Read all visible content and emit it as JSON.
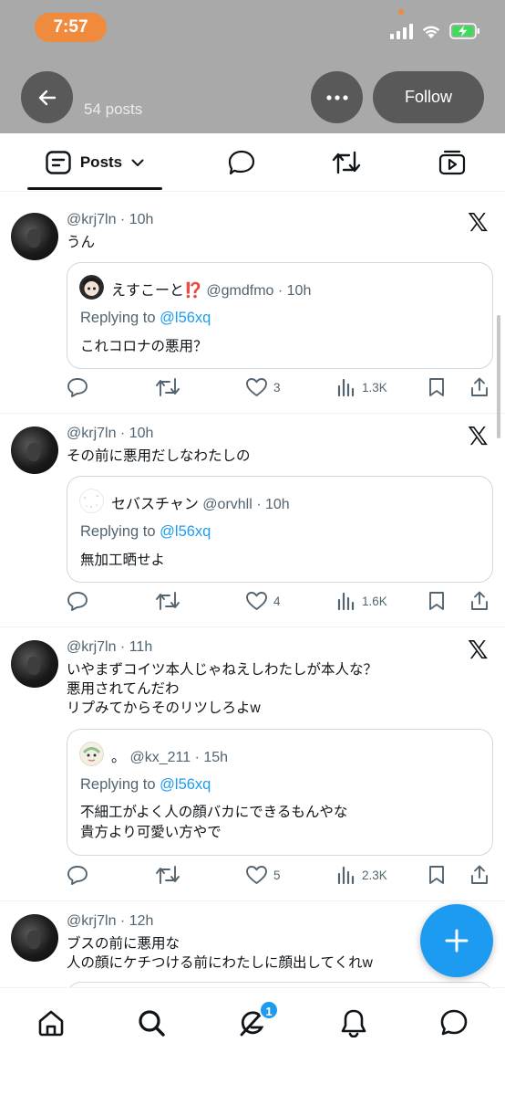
{
  "status_bar": {
    "time": "7:57"
  },
  "header": {
    "post_count": "54 posts",
    "follow_label": "Follow"
  },
  "tabs": [
    {
      "label": "Posts"
    }
  ],
  "posts": [
    {
      "handle": "@krj7ln",
      "time": "10h",
      "text": "うん",
      "quote": {
        "name": "えすこーと⁉️",
        "handle": "@gmdfmo",
        "time": "10h",
        "replying_to_label": "Replying to",
        "replying_to": "@l56xq",
        "text": "これコロナの悪用？"
      },
      "stats": {
        "likes": "3",
        "views": "1.3K"
      }
    },
    {
      "handle": "@krj7ln",
      "time": "10h",
      "text": "その前に悪用だしなわたしの",
      "quote": {
        "name": "セバスチャン",
        "handle": "@orvhll",
        "time": "10h",
        "replying_to_label": "Replying to",
        "replying_to": "@l56xq",
        "text": "無加工晒せよ"
      },
      "stats": {
        "likes": "4",
        "views": "1.6K"
      }
    },
    {
      "handle": "@krj7ln",
      "time": "11h",
      "text": "いやまずコイツ本人じゃねえしわたしが本人な？\n悪用されてんだわ\nリプみてからそのリツしろよw",
      "quote": {
        "name": "。",
        "handle": "@kx_211",
        "time": "15h",
        "replying_to_label": "Replying to",
        "replying_to": "@l56xq",
        "text": "不細工がよく人の顔バカにできるもんやな\n貴方より可愛い方やで"
      },
      "stats": {
        "likes": "5",
        "views": "2.3K"
      }
    },
    {
      "handle": "@krj7ln",
      "time": "12h",
      "text": "ブスの前に悪用な\n人の顔にケチつける前にわたしに顔出してくれw"
    }
  ],
  "bottom_nav": {
    "messages_badge": "1"
  },
  "icons": {
    "back": "arrow-left-icon",
    "more": "more-horizontal-icon",
    "posts_tab": "posts-tab-icon",
    "replies_tab": "speech-bubble-icon",
    "reposts_tab": "repost-icon",
    "media_tab": "video-tab-icon",
    "x_logo": "x-logo-icon",
    "reply": "reply-icon",
    "repost": "repost-icon",
    "like": "heart-icon",
    "views": "views-chart-icon",
    "bookmark": "bookmark-icon",
    "share": "share-icon",
    "compose": "plus-icon",
    "home": "home-icon",
    "search": "search-icon",
    "grok": "grok-icon",
    "notifications": "bell-icon",
    "messages": "chat-icon"
  },
  "colors": {
    "accent": "#1d9bf0",
    "time_pill": "#f08a3c",
    "header_bg": "#a9a9a9"
  }
}
